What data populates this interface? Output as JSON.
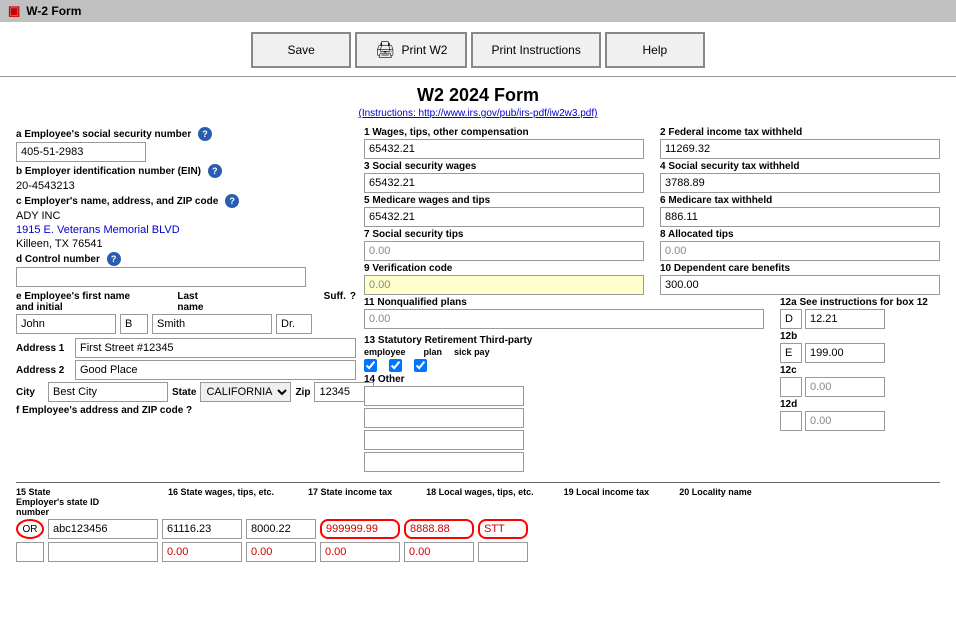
{
  "titleBar": {
    "icon": "W2",
    "title": "W-2 Form"
  },
  "toolbar": {
    "save": "Save",
    "printW2": "Print W2",
    "printInstructions": "Print Instructions",
    "help": "Help"
  },
  "formTitle": "W2 2024 Form",
  "formLink": "(Instructions: http://www.irs.gov/pub/irs-pdf/iw2w3.pdf)",
  "left": {
    "ssnLabel": "a Employee's social security number",
    "ssnValue": "405-51-2983",
    "einLabel": "b Employer identification number (EIN)",
    "einValue": "20-4543213",
    "empNameLabel": "c Employer's name, address, and ZIP code",
    "empName": "ADY INC",
    "empAddr": "1915 E. Veterans Memorial BLVD",
    "empCity": "Killeen, TX 76541",
    "controlLabel": "d Control number",
    "empFirstLabel": "e Employee's first name and initial",
    "empLastLabel": "Last name",
    "suffLabel": "Suff.",
    "firstName": "John",
    "middleInitial": "B",
    "lastName": "Smith",
    "suffix": "Dr.",
    "addr1Label": "Address 1",
    "addr1": "First Street #12345",
    "addr2Label": "Address 2",
    "addr2": "Good Place",
    "cityLabel": "City",
    "cityValue": "Best City",
    "stateLabel": "State",
    "stateValue": "CALIFORNIA",
    "zipLabel": "Zip",
    "zipValue": "12345",
    "fAddrLabel": "f Employee's address and ZIP code"
  },
  "right": {
    "box1Label": "1 Wages, tips, other compensation",
    "box1Value": "65432.21",
    "box2Label": "2 Federal income tax withheld",
    "box2Value": "11269.32",
    "box3Label": "3 Social security wages",
    "box3Value": "65432.21",
    "box4Label": "4 Social security tax withheld",
    "box4Value": "3788.89",
    "box5Label": "5 Medicare wages and tips",
    "box5Value": "65432.21",
    "box6Label": "6 Medicare tax withheld",
    "box6Value": "886.11",
    "box7Label": "7 Social security tips",
    "box7Value": "0.00",
    "box8Label": "8 Allocated tips",
    "box8Value": "0.00",
    "box9Label": "9 Verification code",
    "box9Value": "0.00",
    "box10Label": "10 Dependent care benefits",
    "box10Value": "300.00",
    "box11Label": "11 Nonqualified plans",
    "box11Value": "0.00",
    "box12aLabel": "12a See instructions for box 12",
    "box12aCode": "D",
    "box12aValue": "12.21",
    "box12bLabel": "12b",
    "box12bCode": "E",
    "box12bValue": "199.00",
    "box12cLabel": "12c",
    "box12cCode": "",
    "box12cValue": "0.00",
    "box12dLabel": "12d",
    "box12dCode": "",
    "box12dValue": "0.00",
    "box13Label": "13 Statutory Retirement Third-party",
    "box13Col1": "employee",
    "box13Col2": "plan",
    "box13Col3": "sick pay",
    "box14Label": "14 Other",
    "box14Values": [
      "",
      "",
      "",
      ""
    ]
  },
  "stateSection": {
    "col15Label": "15 State",
    "col15bLabel": "Employer's state ID number",
    "col16Label": "16 State wages, tips, etc.",
    "col17Label": "17 State income tax",
    "col18Label": "18 Local wages, tips, etc.",
    "col19Label": "19 Local income tax",
    "col20Label": "20 Locality name",
    "row1": {
      "state": "OR",
      "stateId": "abc123456",
      "stateWages": "61116.23",
      "stateTax": "8000.22",
      "localWages": "999999.99",
      "localTax": "8888.88",
      "locality": "STT"
    },
    "row2": {
      "state": "",
      "stateId": "",
      "stateWages": "0.00",
      "stateTax": "0.00",
      "localWages": "0.00",
      "localTax": "0.00",
      "locality": ""
    }
  }
}
